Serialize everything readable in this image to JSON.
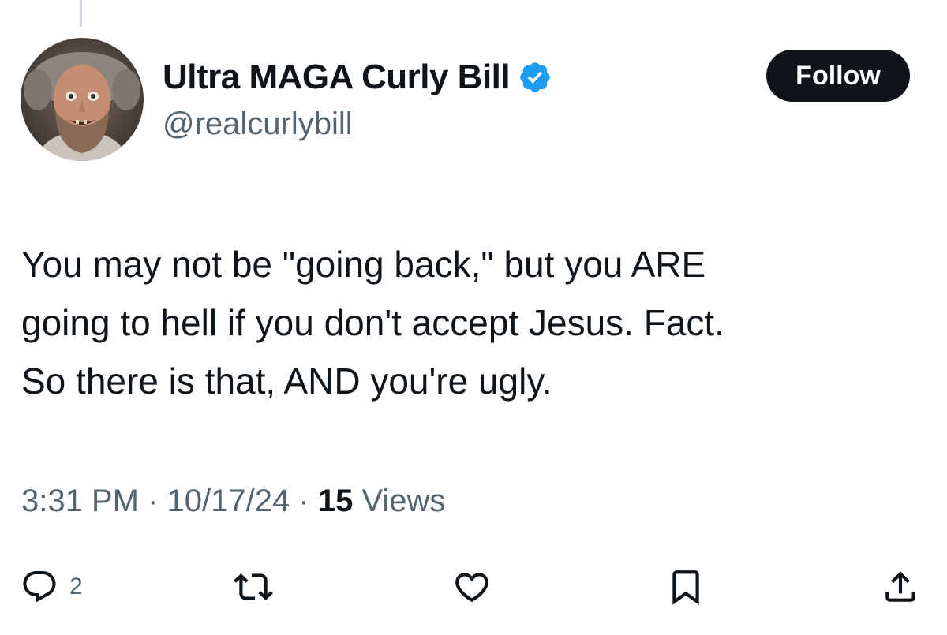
{
  "author": {
    "display_name": "Ultra MAGA Curly Bill",
    "handle": "@realcurlybill",
    "verified": true,
    "verified_color": "#1d9bf0"
  },
  "follow_label": "Follow",
  "tweet": {
    "lines": [
      "You may not be \"going back,\" but you ARE",
      "going to hell if you don't accept Jesus. Fact.",
      "So there is that, AND you're ugly."
    ]
  },
  "meta": {
    "time": "3:31 PM",
    "separator": "·",
    "date": "10/17/24",
    "views_count": "15",
    "views_label": "Views"
  },
  "actions": {
    "reply_count": "2",
    "icons": [
      "reply-icon",
      "retweet-icon",
      "like-icon",
      "bookmark-icon",
      "share-icon"
    ]
  },
  "colors": {
    "text": "#0f1419",
    "secondary": "#536471",
    "button_bg": "#0f1419"
  }
}
